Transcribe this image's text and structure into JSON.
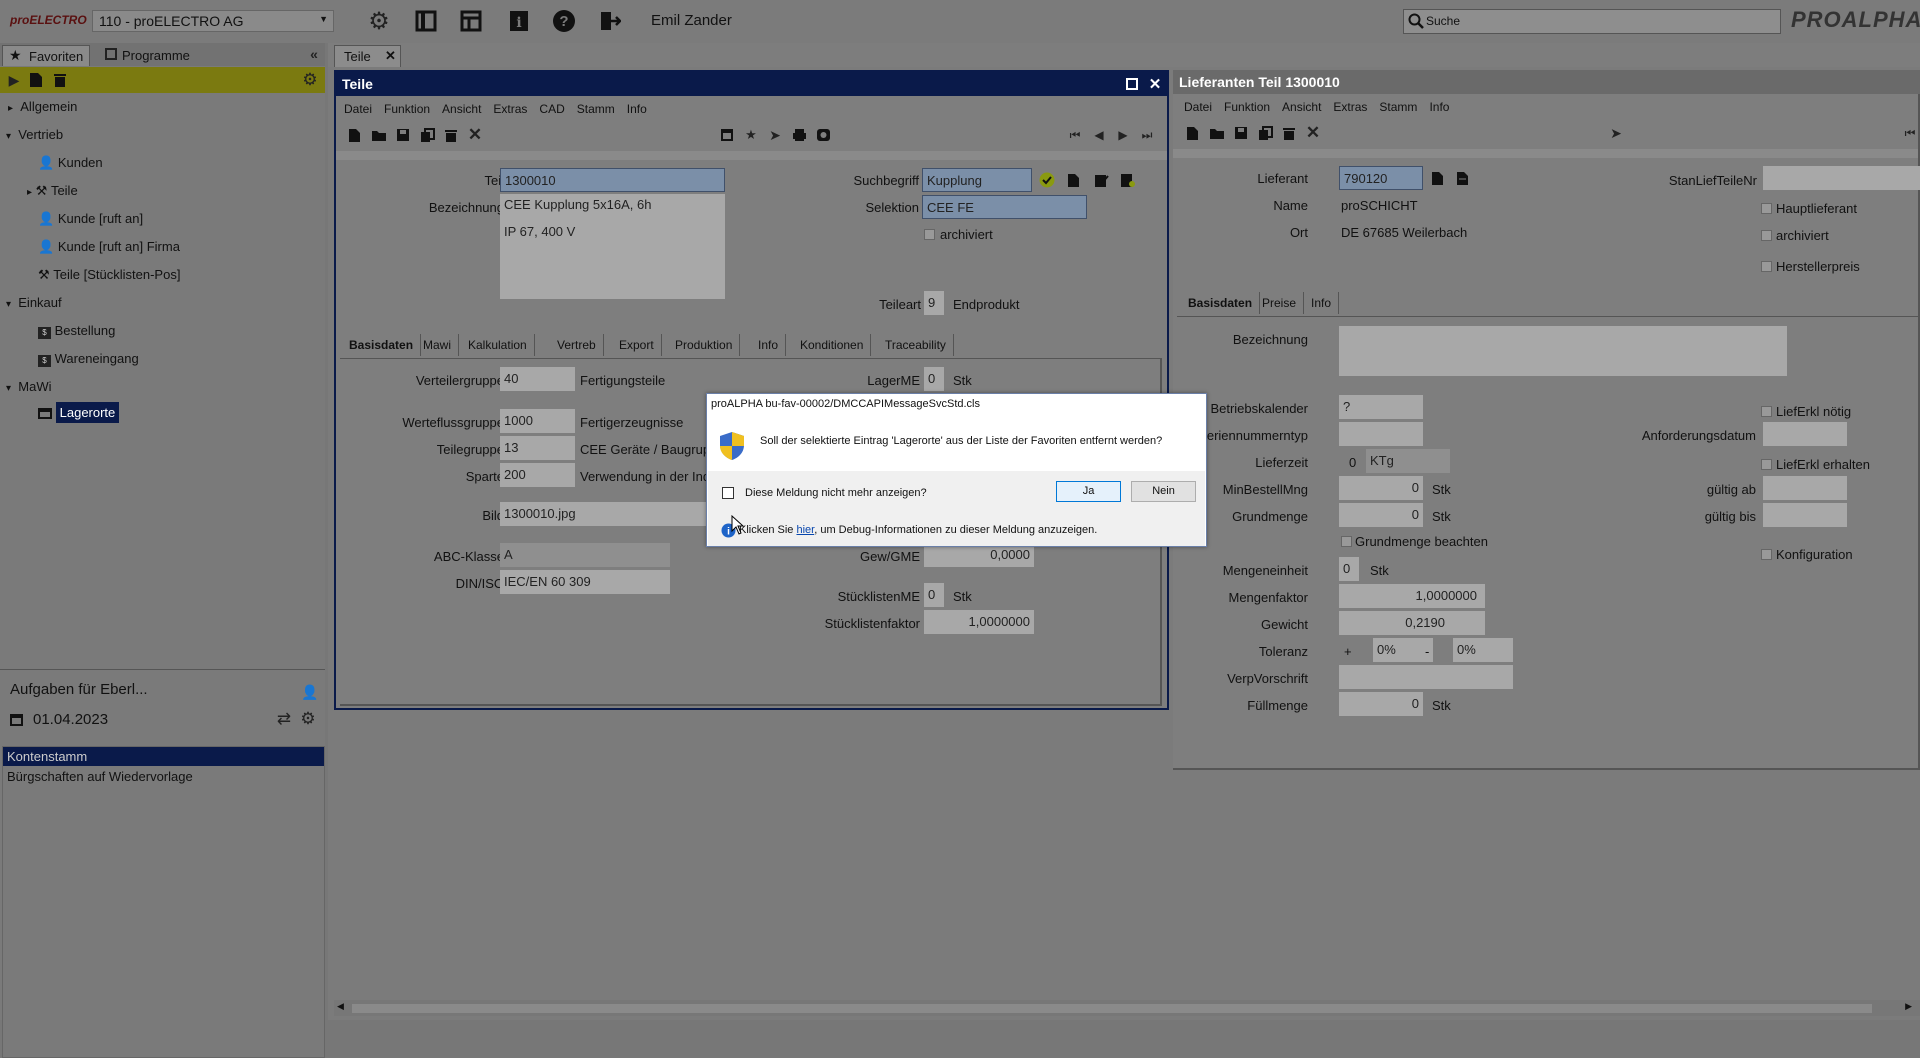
{
  "topbar": {
    "logo": "proELECTRO",
    "company": "110 - proELECTRO AG",
    "user": "Emil Zander",
    "search_placeholder": "Suche",
    "brand": "PROALPHA"
  },
  "leftpanel": {
    "tabs": [
      "Favoriten",
      "Programme"
    ],
    "tree": [
      {
        "label": "Allgemein",
        "level": 0,
        "arrow": "▸"
      },
      {
        "label": "Vertrieb",
        "level": 0,
        "arrow": "▾"
      },
      {
        "label": "Kunden",
        "level": 1,
        "icon": "person-icon"
      },
      {
        "label": "Teile",
        "level": 1,
        "icon": "parts-icon",
        "arrow": "▸"
      },
      {
        "label": "Kunde [ruft an]",
        "level": 1,
        "icon": "person-icon"
      },
      {
        "label": "Kunde [ruft an] Firma",
        "level": 1,
        "icon": "person-icon"
      },
      {
        "label": "Teile [Stücklisten-Pos]",
        "level": 1,
        "icon": "parts-icon"
      },
      {
        "label": "Einkauf",
        "level": 0,
        "arrow": "▾"
      },
      {
        "label": "Bestellung",
        "level": 1,
        "icon": "order-icon"
      },
      {
        "label": "Wareneingang",
        "level": 1,
        "icon": "order-icon"
      },
      {
        "label": "MaWi",
        "level": 0,
        "arrow": "▾"
      },
      {
        "label": "Lagerorte",
        "level": 1,
        "icon": "window-icon",
        "selected": true
      }
    ],
    "tasks_title": "Aufgaben für Eberl...",
    "tasks_date": "01.04.2023",
    "tasks": [
      "Kontenstamm",
      "Bürgschaften auf Wiedervorlage"
    ]
  },
  "doc_tab": "Teile",
  "teile": {
    "title": "Teile",
    "menu": [
      "Datei",
      "Funktion",
      "Ansicht",
      "Extras",
      "CAD",
      "Stamm",
      "Info"
    ],
    "teil_label": "Teil",
    "teil": "1300010",
    "bez_label": "Bezeichnung",
    "bez1": "CEE Kupplung 5x16A, 6h",
    "bez2": "IP 67, 400 V",
    "such_label": "Suchbegriff",
    "such": "Kupplung",
    "sel_label": "Selektion",
    "sel": "CEE FE",
    "archiviert": "archiviert",
    "teileart_label": "Teileart",
    "teileart": "9",
    "teileart_text": "Endprodukt",
    "tabs": [
      "Basisdaten",
      "Mawi",
      "Kalkulation",
      "Vertreb",
      "Export",
      "Produktion",
      "Info",
      "Konditionen",
      "Traceability"
    ],
    "vg_label": "Verteilergruppe",
    "vg": "40",
    "vg_text": "Fertigungsteile",
    "lagerme_label": "LagerME",
    "lagerme": "0",
    "lagerme_unit": "Stk",
    "wfg_label": "Werteflussgruppe",
    "wfg": "1000",
    "wfg_text": "Fertigerzeugnisse",
    "tg_label": "Teilegruppe",
    "tg": "13",
    "tg_text": "CEE Geräte / Baugrup",
    "sp_label": "Sparte",
    "sp": "200",
    "sp_text": "Verwendung in der Ind",
    "bild_label": "Bild",
    "bild": "1300010.jpg",
    "abc_label": "ABC-Klasse",
    "abc": "A",
    "din_label": "DIN/ISO",
    "din": "IEC/EN 60 309",
    "gew_label": "Gew/GME",
    "gew": "0,0000",
    "sme_label": "StücklistenME",
    "sme": "0",
    "sme_unit": "Stk",
    "sf_label": "Stücklistenfaktor",
    "sf": "1,0000000"
  },
  "lief": {
    "title": "Lieferanten Teil 1300010",
    "menu": [
      "Datei",
      "Funktion",
      "Ansicht",
      "Extras",
      "Stamm",
      "Info"
    ],
    "lief_label": "Lieferant",
    "lief": "790120",
    "name_label": "Name",
    "name": "proSCHICHT",
    "ort_label": "Ort",
    "ort": "DE 67685 Weilerbach",
    "stan_label": "StanLiefTeileNr",
    "haupt": "Hauptlieferant",
    "archiviert": "archiviert",
    "hersteller": "Herstellerpreis",
    "tabs": [
      "Basisdaten",
      "Preise",
      "Info"
    ],
    "bez_label": "Bezeichnung",
    "bk_label": "Betriebskalender",
    "bk": "?",
    "snt_label": "Seriennummerntyp",
    "lz_label": "Lieferzeit",
    "lz": "0",
    "lz_unit": "KTg",
    "mbm_label": "MinBestellMng",
    "mbm": "0",
    "mbm_unit": "Stk",
    "gm_label": "Grundmenge",
    "gm": "0",
    "gm_unit": "Stk",
    "gmb": "Grundmenge beachten",
    "me_label": "Mengeneinheit",
    "me": "0",
    "me_unit": "Stk",
    "mf_label": "Mengenfaktor",
    "mf": "1,0000000",
    "gw_label": "Gewicht",
    "gw": "0,2190",
    "tol_label": "Toleranz",
    "tol_plus": "+",
    "tol1": "0%",
    "tol_minus": "-",
    "tol2": "0%",
    "vv_label": "VerpVorschrift",
    "fm_label": "Füllmenge",
    "fm": "0",
    "fm_unit": "Stk",
    "lieferkl_noetig": "LiefErkl nötig",
    "af_label": "Anforderungsdatum",
    "lieferkl_erhalten": "LiefErkl erhalten",
    "gab_label": "gültig ab",
    "gbis_label": "gültig bis",
    "konfig": "Konfiguration"
  },
  "dialog": {
    "title": "proALPHA bu-fav-00002/DMCCAPIMessageSvcStd.cls",
    "message": "Soll der selektierte Eintrag 'Lagerorte' aus der Liste der Favoriten entfernt werden?",
    "checkbox": "Diese Meldung nicht mehr anzeigen?",
    "yes": "Ja",
    "no": "Nein",
    "info_pre": "Klicken Sie ",
    "info_link": "hier",
    "info_post": ", um Debug-Informationen zu dieser Meldung anzuzeigen."
  },
  "colors": {
    "accent": "#0a1a4a",
    "toolbar_green": "#7b7a10",
    "field": "#a8a8a8",
    "field_blue": "#7b8fa8"
  }
}
